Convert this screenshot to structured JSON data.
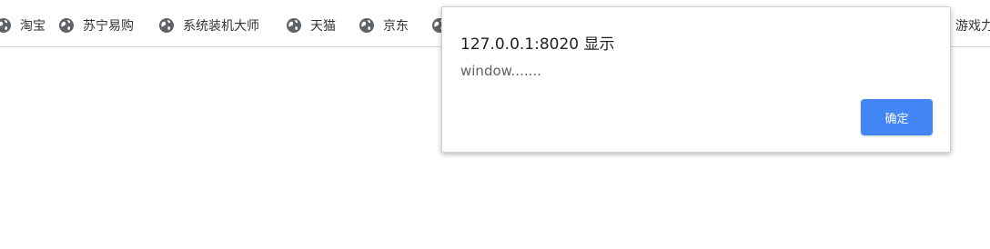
{
  "bookmarks": [
    {
      "label": "淘宝",
      "icon": "globe-icon"
    },
    {
      "label": "苏宁易购",
      "icon": "globe-icon"
    },
    {
      "label": "系统装机大师",
      "icon": "globe-icon"
    },
    {
      "label": "天猫",
      "icon": "globe-icon"
    },
    {
      "label": "京东",
      "icon": "globe-icon"
    },
    {
      "label": "",
      "icon": "globe-icon"
    },
    {
      "label": "游戏力",
      "icon": "globe-icon"
    }
  ],
  "dialog": {
    "title": "127.0.0.1:8020 显示",
    "message": "window.......",
    "ok_label": "确定"
  },
  "colors": {
    "accent": "#4285f4",
    "icon": "#5f6368"
  }
}
